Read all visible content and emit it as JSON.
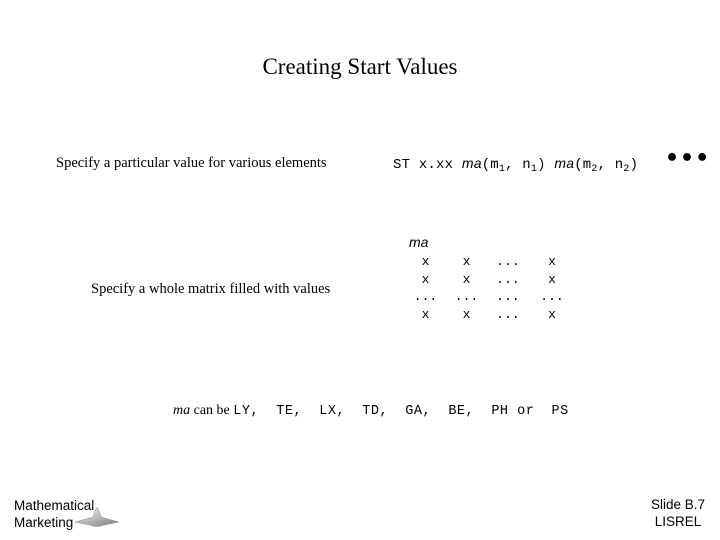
{
  "slide": {
    "title": "Creating Start Values",
    "row1": {
      "label": "Specify a particular value for various elements",
      "command": {
        "keyword": "ST",
        "value": "x.xx",
        "matrix1": "ma",
        "args1_open": "(m",
        "args1_sub_m": "1",
        "args1_mid": ", n",
        "args1_sub_n": "1",
        "args1_close": ")",
        "matrix2": "ma",
        "args2_open": "(m",
        "args2_sub_m": "2",
        "args2_mid": ", n",
        "args2_sub_n": "2",
        "args2_close": ")"
      },
      "continuation": "•••"
    },
    "row2": {
      "label": "Specify a whole matrix filled with values",
      "matrix_name": "ma",
      "matrix_rows": [
        [
          "x",
          "x",
          "...",
          "x"
        ],
        [
          "x",
          "x",
          "...",
          "x"
        ],
        [
          "...",
          "...",
          "...",
          "..."
        ],
        [
          "x",
          "x",
          "...",
          "x"
        ]
      ]
    },
    "note": {
      "prefix_italic": "ma",
      "text": " can be ",
      "options": "LY,  TE,  LX,  TD,  GA,  BE,  PH or  PS"
    },
    "footer": {
      "logo_line1": "Mathematical",
      "logo_line2": "Marketing",
      "logo_icon": "bell-surface-icon",
      "slide_number": "Slide B.7",
      "section": "LISREL"
    }
  }
}
